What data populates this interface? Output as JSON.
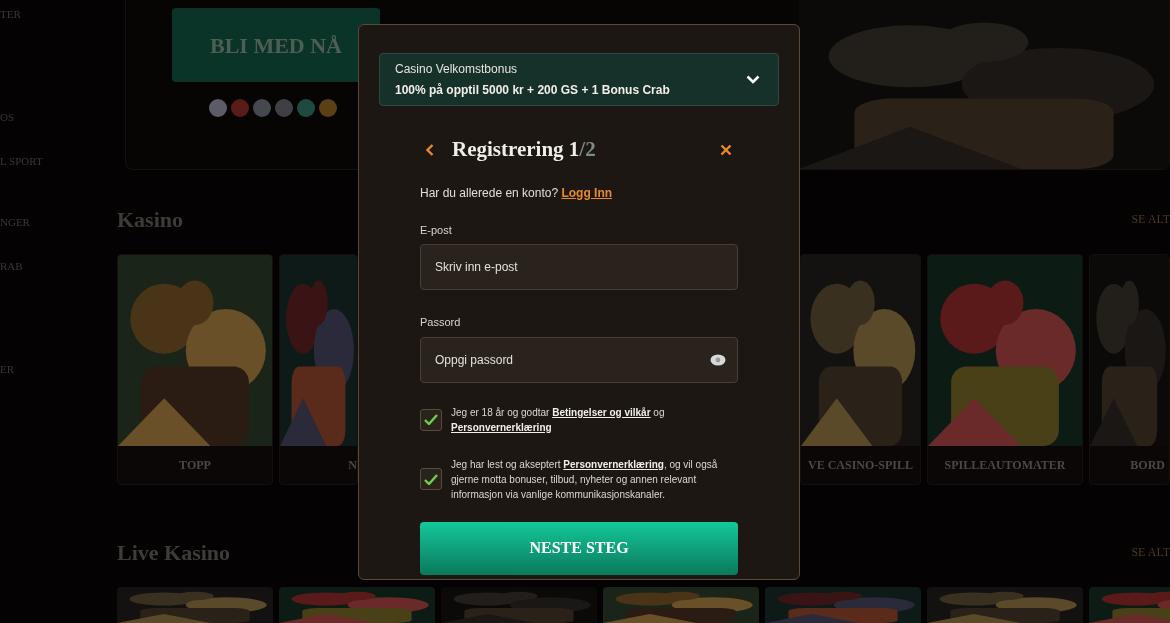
{
  "sidebar": {
    "items": [
      {
        "label": "TER"
      },
      {
        "label": "OS"
      },
      {
        "label": "L SPORT"
      },
      {
        "label": "NGER"
      },
      {
        "label": "RAB"
      },
      {
        "label": "ER"
      }
    ]
  },
  "hero": {
    "cta": "BLI MED NÅ",
    "payment_methods": [
      {
        "color": "#5c5c66"
      },
      {
        "color": "#5a1c18"
      },
      {
        "color": "#46484f"
      },
      {
        "color": "#3e4046"
      },
      {
        "color": "#1f4a40"
      },
      {
        "color": "#5a4012"
      }
    ]
  },
  "sections": [
    {
      "title": "Kasino",
      "see_all": "SE ALT",
      "cards": [
        {
          "label": "TOPP",
          "kind": "full"
        },
        {
          "label": "N",
          "kind": "clipped-left"
        },
        {
          "label": "VE CASINO-SPILL",
          "kind": "clipped-right"
        },
        {
          "label": "SPILLEAUTOMATER",
          "kind": "full"
        },
        {
          "label": "BORD",
          "kind": "edge"
        }
      ]
    },
    {
      "title": "Live Kasino",
      "see_all": "SE ALT"
    }
  ],
  "modal": {
    "bonus": {
      "title": "Casino Velkomstbonus",
      "offer": "100% på opptil 5000 kr + 200 GS + 1 Bonus Crab",
      "expanded": false
    },
    "title": "Registrering 1",
    "step_total": "/2",
    "login_prompt": "Har du allerede en konto?",
    "login_link": "Logg Inn",
    "fields": [
      {
        "label": "E-post",
        "placeholder": "Skriv inn e-post",
        "kind": "email"
      },
      {
        "label": "Passord",
        "placeholder": "Oppgi passord",
        "kind": "password"
      }
    ],
    "consents": [
      {
        "checked": true,
        "parts": [
          {
            "kind": "text",
            "text": "Jeg er 18 år og godtar "
          },
          {
            "kind": "link",
            "text": "Betingelser og vilkår"
          },
          {
            "kind": "text",
            "text": " og "
          },
          {
            "kind": "link",
            "text": "Personvernerklæring"
          }
        ]
      },
      {
        "checked": true,
        "parts": [
          {
            "kind": "text",
            "text": "Jeg har lest og akseptert "
          },
          {
            "kind": "link",
            "text": "Personvernerklæring"
          },
          {
            "kind": "text",
            "text": ", og vil også gjerne motta bonuser, tilbud, nyheter og annen relevant informasjon via vanlige kommunikasjonskanaler."
          }
        ]
      }
    ],
    "submit": "NESTE STEG"
  }
}
